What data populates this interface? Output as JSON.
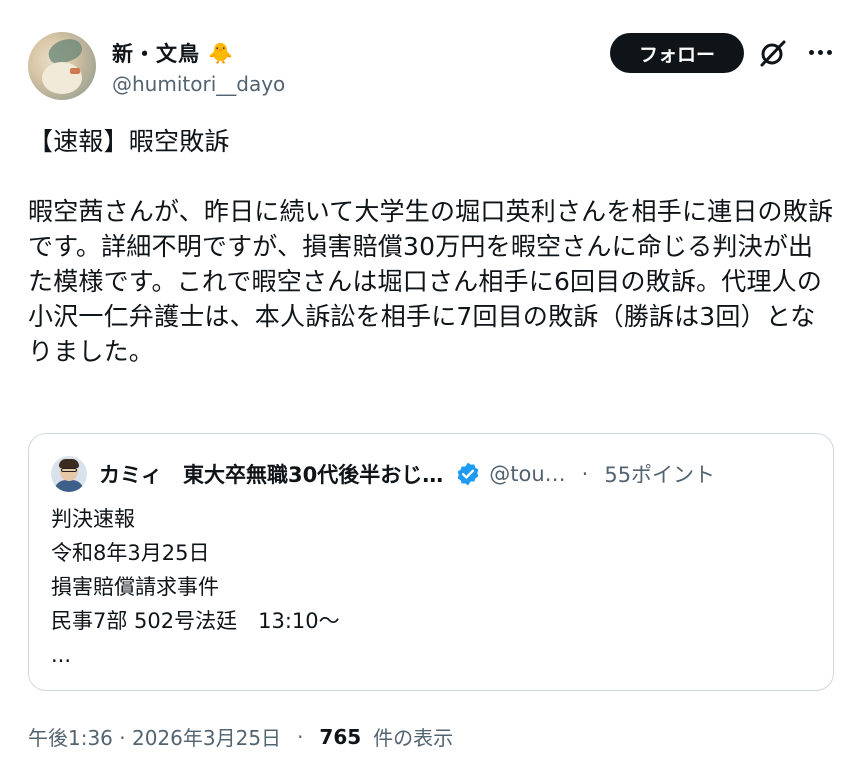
{
  "author": {
    "display_name": "新・文鳥",
    "emoji": "🐥",
    "handle": "@humitori__dayo"
  },
  "actions": {
    "follow_label": "フォロー"
  },
  "post": {
    "text": "【速報】暇空敗訴\n\n暇空茜さんが、昨日に続いて大学生の堀口英利さんを相手に連日の敗訴です。詳細不明ですが、損害賠償30万円を暇空さんに命じる判決が出た模様です。これで暇空さんは堀口さん相手に6回目の敗訴。代理人の小沢一仁弁護士は、本人訴訟を相手に7回目の敗訴（勝訴は3回）となりました。"
  },
  "quote": {
    "name": "カミィ　東大卒無職30代後半おじ…",
    "handle": "@tou…",
    "dot": "·",
    "points": "55ポイント",
    "text": "判決速報\n令和8年3月25日\n損害賠償請求事件\n民事7部 502号法廷　13:10〜\n..."
  },
  "meta": {
    "timestamp": "午後1:36 · 2026年3月25日",
    "dot": "·",
    "views": "765",
    "views_label": "件の表示"
  },
  "colors": {
    "text": "#0f1419",
    "secondary": "#536471",
    "border": "#cfd9de",
    "verified": "#1d9bf0"
  }
}
